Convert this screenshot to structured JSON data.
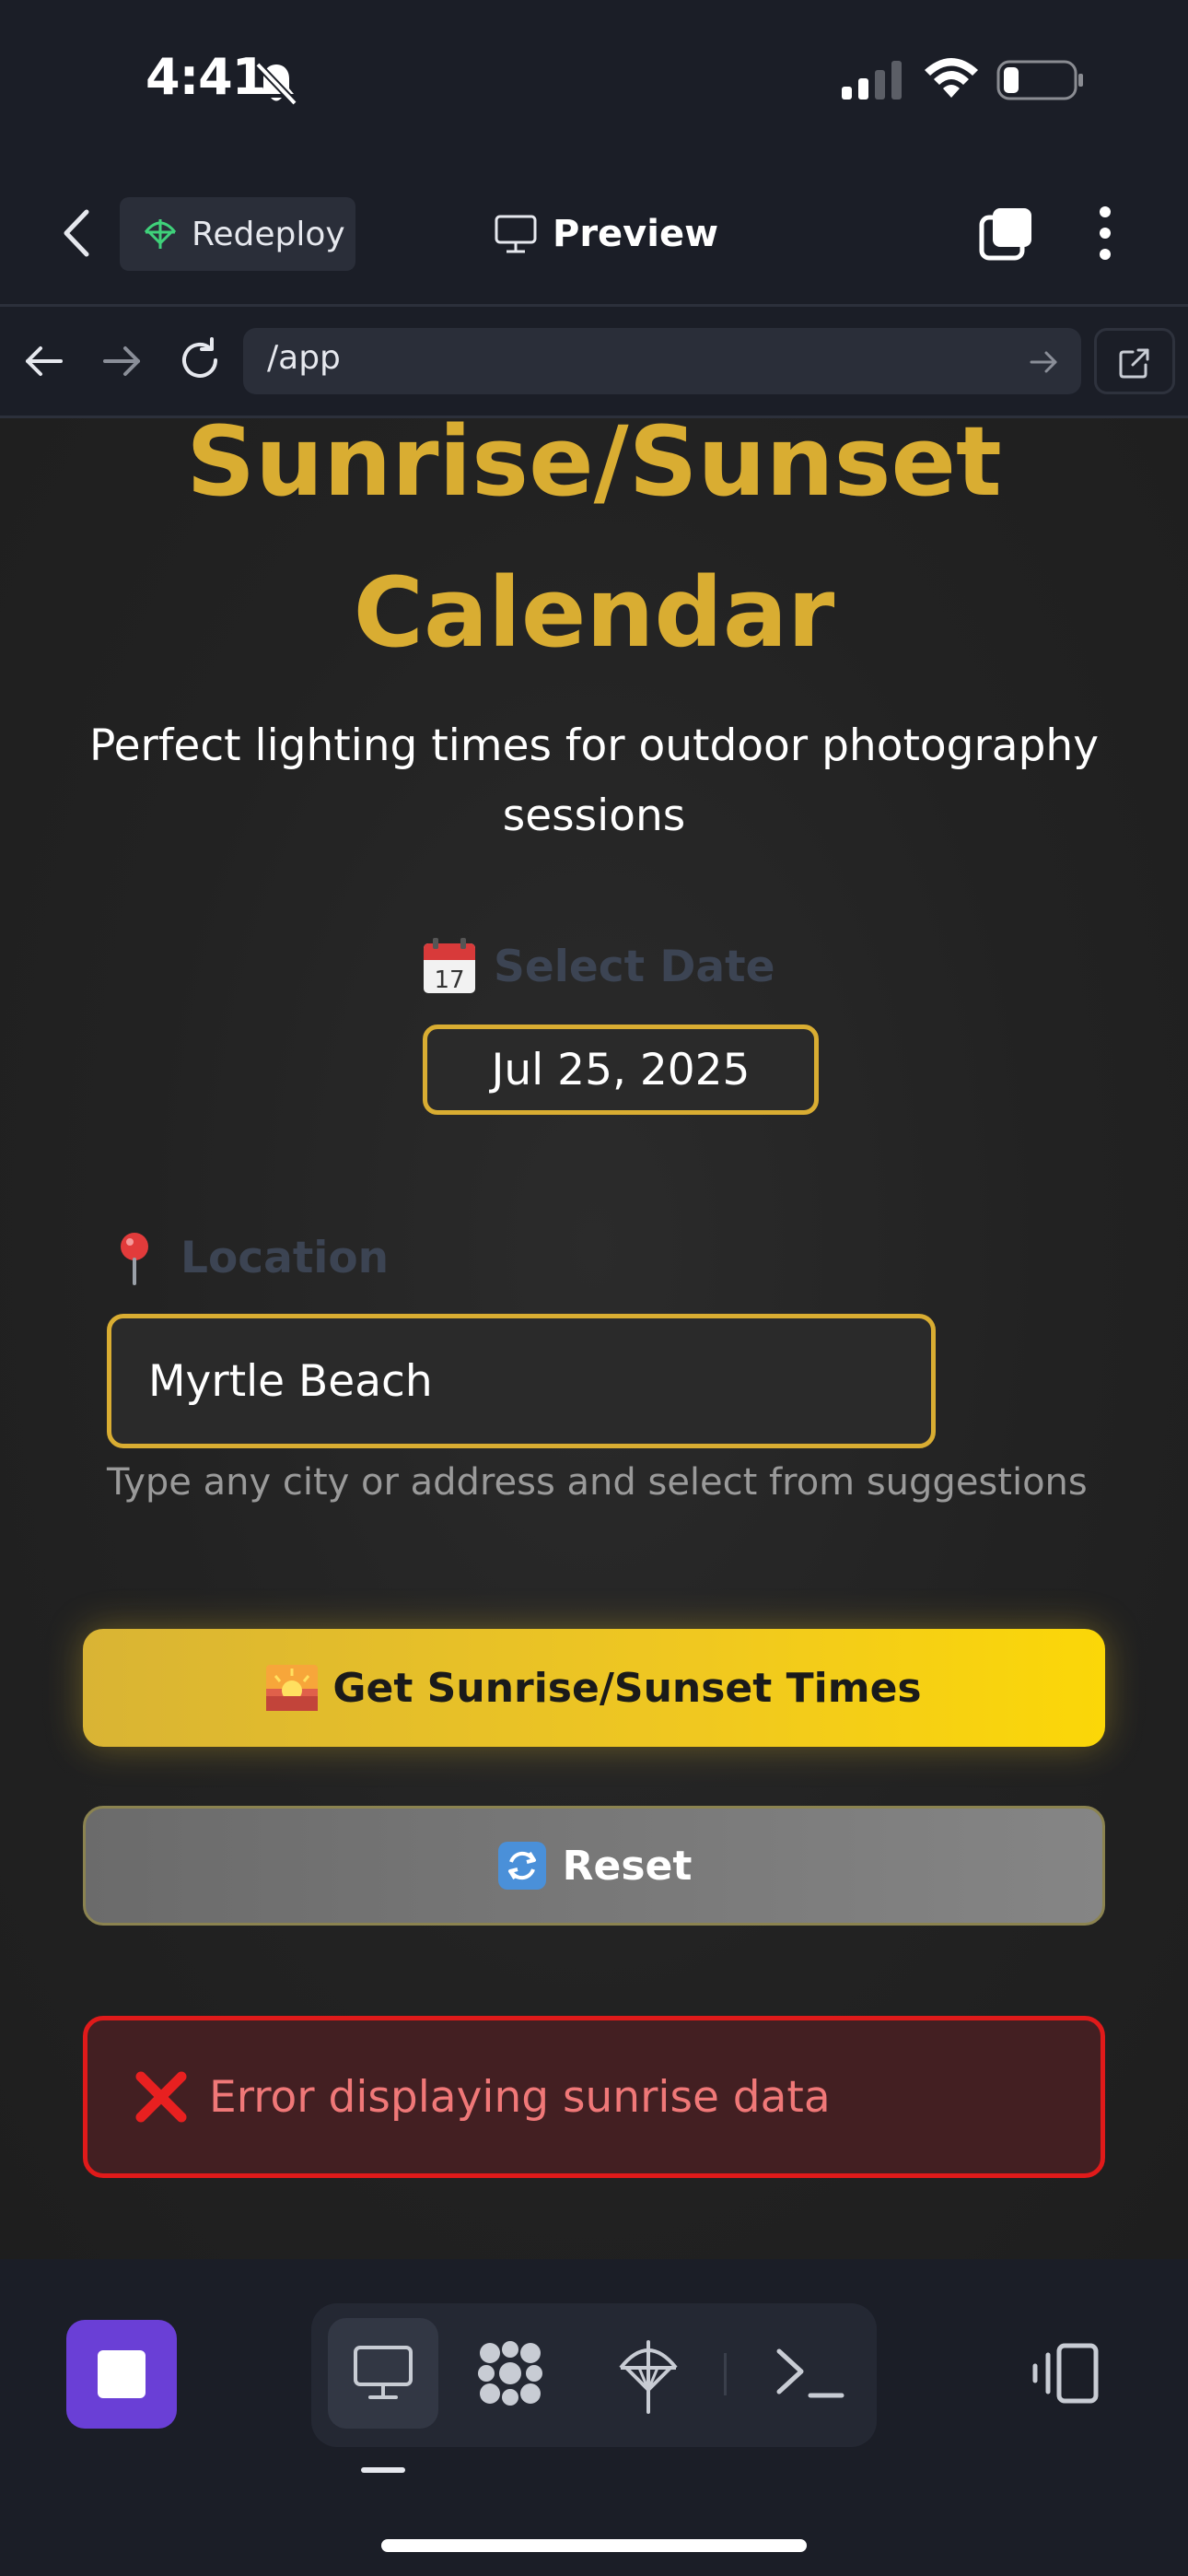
{
  "status_bar": {
    "time": "4:41",
    "icons": [
      "bell-slash-icon",
      "signal-icon",
      "wifi-icon",
      "battery-icon"
    ]
  },
  "top_bar": {
    "redeploy_label": "Redeploy",
    "preview_label": "Preview"
  },
  "browser": {
    "url": "/app"
  },
  "app": {
    "title_line1": "Sunrise/Sunset",
    "title_line2": "Calendar",
    "subtitle": "Perfect lighting times for outdoor photography sessions",
    "date_label": "Select Date",
    "date_value": "Jul 25, 2025",
    "location_label": "Location",
    "location_value": "Myrtle Beach",
    "location_hint": "Type any city or address and select from suggestions",
    "get_times_label": "Get Sunrise/Sunset Times",
    "reset_label": "Reset",
    "error_message": "Error displaying sunrise data"
  },
  "colors": {
    "accent": "#d9ad32",
    "error": "#e01a1a",
    "stop": "#6a3fd6",
    "background": "#1b1e27"
  },
  "bottom_bar": {
    "tools": [
      "preview-tool",
      "apps-tool",
      "deploy-tool",
      "shell-tool"
    ],
    "active_tool": "preview-tool"
  }
}
